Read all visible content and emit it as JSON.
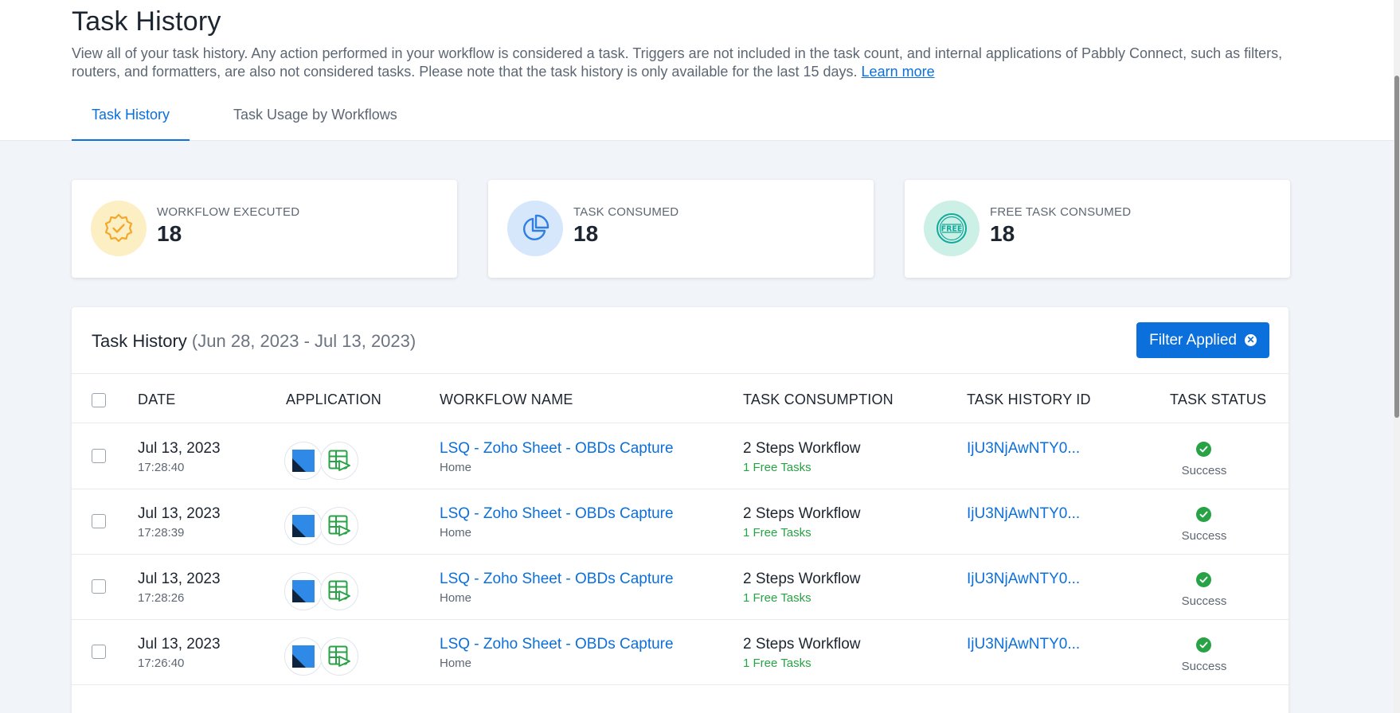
{
  "header": {
    "title": "Task History",
    "description": "View all of your task history. Any action performed in your workflow is considered a task. Triggers are not included in the task count, and internal applications of Pabbly Connect, such as filters, routers, and formatters, are also not considered tasks. Please note that the task history is only available for the last 15 days.",
    "learn_more": "Learn more"
  },
  "tabs": [
    {
      "label": "Task History",
      "active": true
    },
    {
      "label": "Task Usage by Workflows",
      "active": false
    }
  ],
  "stats": [
    {
      "label": "WORKFLOW EXECUTED",
      "value": "18",
      "icon": "badge-check-icon",
      "bg": "#fdefc4",
      "color": "#f2a92b"
    },
    {
      "label": "TASK CONSUMED",
      "value": "18",
      "icon": "pie-chart-icon",
      "bg": "#d6e6fb",
      "color": "#2e7fe0"
    },
    {
      "label": "FREE TASK CONSUMED",
      "value": "18",
      "icon": "free-stamp-icon",
      "bg": "#ccefe6",
      "color": "#13a99b"
    }
  ],
  "panel": {
    "title": "Task History",
    "date_range": "(Jun 28, 2023 - Jul 13, 2023)",
    "filter_label": "Filter Applied"
  },
  "columns": {
    "date": "DATE",
    "application": "APPLICATION",
    "workflow_name": "WORKFLOW NAME",
    "task_consumption": "TASK CONSUMPTION",
    "task_history_id": "TASK HISTORY ID",
    "task_status": "TASK STATUS"
  },
  "rows": [
    {
      "date": "Jul 13, 2023",
      "time": "17:28:40",
      "workflow": "LSQ - Zoho Sheet - OBDs Capture",
      "folder": "Home",
      "consumption": "2 Steps Workflow",
      "free": "1 Free Tasks",
      "id": "IjU3NjAwNTY0...",
      "status": "Success"
    },
    {
      "date": "Jul 13, 2023",
      "time": "17:28:39",
      "workflow": "LSQ - Zoho Sheet - OBDs Capture",
      "folder": "Home",
      "consumption": "2 Steps Workflow",
      "free": "1 Free Tasks",
      "id": "IjU3NjAwNTY0...",
      "status": "Success"
    },
    {
      "date": "Jul 13, 2023",
      "time": "17:28:26",
      "workflow": "LSQ - Zoho Sheet - OBDs Capture",
      "folder": "Home",
      "consumption": "2 Steps Workflow",
      "free": "1 Free Tasks",
      "id": "IjU3NjAwNTY0...",
      "status": "Success"
    },
    {
      "date": "Jul 13, 2023",
      "time": "17:26:40",
      "workflow": "LSQ - Zoho Sheet - OBDs Capture",
      "folder": "Home",
      "consumption": "2 Steps Workflow",
      "free": "1 Free Tasks",
      "id": "IjU3NjAwNTY0...",
      "status": "Success"
    }
  ],
  "row_apps": [
    "leadsquared-icon",
    "zoho-sheet-icon"
  ],
  "colors": {
    "accent": "#0b6fdc",
    "success": "#27a244"
  }
}
